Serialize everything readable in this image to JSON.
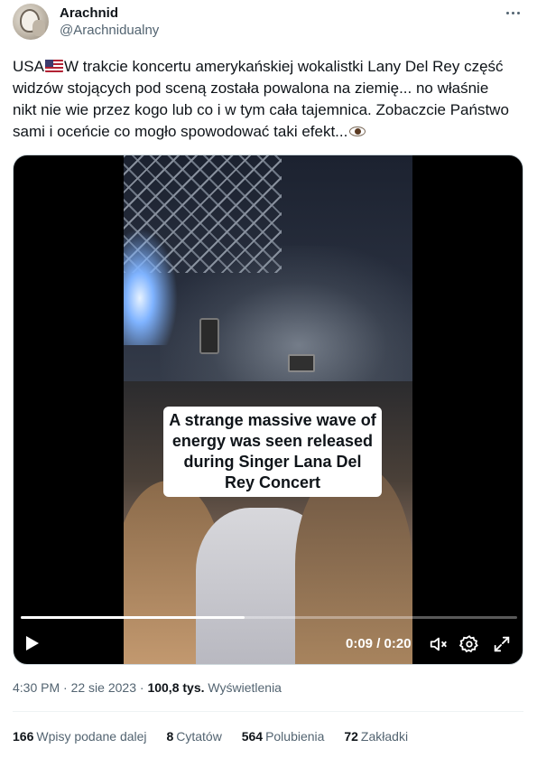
{
  "author": {
    "name": "Arachnid",
    "handle": "@Arachnidualny"
  },
  "tweet": {
    "text_line1_prefix": "USA",
    "text_line1_rest": "W trakcie koncertu amerykańskiej wokalistki Lany Del Rey część",
    "text_line2": "widzów stojących pod sceną została powalona na ziemię... no właśnie",
    "text_line3": "nikt nie wie przez kogo lub co i w tym cała tajemnica. Zobaczcie Państwo",
    "text_line4": "sami i oceńcie co mogło spowodować taki efekt..."
  },
  "video": {
    "caption": "A strange massive wave of energy was seen released during Singer Lana Del Rey Concert",
    "time_display": "0:09 / 0:20",
    "progress": 0.45
  },
  "meta": {
    "time": "4:30 PM",
    "separator": " · ",
    "date": "22 sie 2023",
    "views_count": "100,8 tys.",
    "views_label": "Wyświetlenia"
  },
  "stats": [
    {
      "count": "166",
      "label": "Wpisy podane dalej"
    },
    {
      "count": "8",
      "label": "Cytatów"
    },
    {
      "count": "564",
      "label": "Polubienia"
    },
    {
      "count": "72",
      "label": "Zakładki"
    }
  ],
  "icons": {
    "flag": "us-flag-icon",
    "eye": "eye-emoji-icon",
    "more": "more-dots-icon",
    "play": "play-icon",
    "mute": "muted-speaker-icon",
    "settings": "gear-icon",
    "fullscreen": "fullscreen-icon"
  }
}
